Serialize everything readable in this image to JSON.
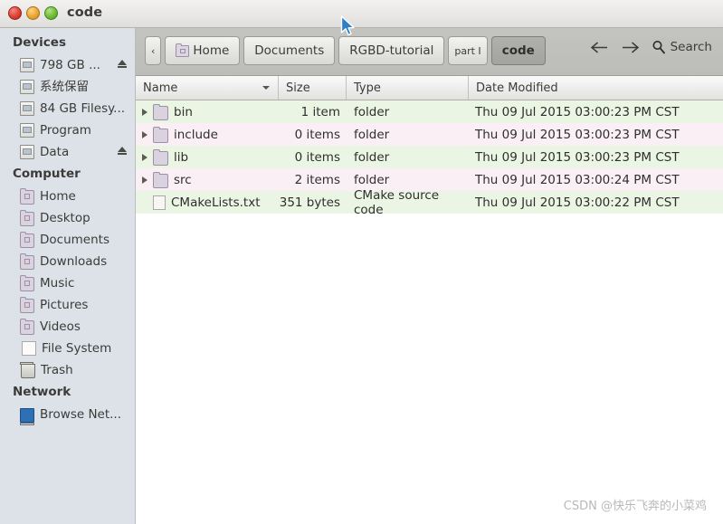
{
  "window": {
    "title": "code",
    "buttons": {
      "close": "close",
      "minimize": "minimize",
      "maximize": "maximize"
    }
  },
  "sidebar": {
    "groups": [
      {
        "heading": "Devices",
        "items": [
          {
            "label": "798 GB ...",
            "icon": "drive-icon",
            "eject": true
          },
          {
            "label": "系统保留",
            "icon": "drive-icon",
            "eject": false
          },
          {
            "label": "84 GB Filesy...",
            "icon": "drive-icon",
            "eject": false
          },
          {
            "label": "Program",
            "icon": "drive-icon",
            "eject": false
          },
          {
            "label": "Data",
            "icon": "drive-icon",
            "eject": true
          }
        ]
      },
      {
        "heading": "Computer",
        "items": [
          {
            "label": "Home",
            "icon": "folder-home-icon",
            "eject": false
          },
          {
            "label": "Desktop",
            "icon": "folder-desktop-icon",
            "eject": false
          },
          {
            "label": "Documents",
            "icon": "folder-documents-icon",
            "eject": false
          },
          {
            "label": "Downloads",
            "icon": "folder-downloads-icon",
            "eject": false
          },
          {
            "label": "Music",
            "icon": "folder-music-icon",
            "eject": false
          },
          {
            "label": "Pictures",
            "icon": "folder-pictures-icon",
            "eject": false
          },
          {
            "label": "Videos",
            "icon": "folder-videos-icon",
            "eject": false
          },
          {
            "label": "File System",
            "icon": "file-system-icon",
            "eject": false
          },
          {
            "label": "Trash",
            "icon": "trash-icon",
            "eject": false
          }
        ]
      },
      {
        "heading": "Network",
        "items": [
          {
            "label": "Browse Net...",
            "icon": "network-icon",
            "eject": false
          }
        ]
      }
    ]
  },
  "pathbar": {
    "overflow_label": "‹",
    "crumbs": [
      {
        "label": "Home",
        "active": false,
        "has_icon": true
      },
      {
        "label": "Documents",
        "active": false,
        "has_icon": false
      },
      {
        "label": "RGBD-tutorial",
        "active": false,
        "has_icon": false
      },
      {
        "label": "part I",
        "active": false,
        "has_icon": false
      },
      {
        "label": "code",
        "active": true,
        "has_icon": false
      }
    ],
    "back_label": "Back",
    "forward_label": "Forward",
    "search_label": "Search"
  },
  "columns": [
    {
      "key": "name",
      "label": "Name",
      "sorted": true
    },
    {
      "key": "size",
      "label": "Size",
      "sorted": false
    },
    {
      "key": "type",
      "label": "Type",
      "sorted": false
    },
    {
      "key": "date",
      "label": "Date Modified",
      "sorted": false
    }
  ],
  "files": [
    {
      "name": "bin",
      "size": "1 item",
      "type": "folder",
      "date": "Thu 09 Jul 2015 03:00:23 PM CST",
      "icon": "folder-icon",
      "expandable": true
    },
    {
      "name": "include",
      "size": "0 items",
      "type": "folder",
      "date": "Thu 09 Jul 2015 03:00:23 PM CST",
      "icon": "folder-icon",
      "expandable": true
    },
    {
      "name": "lib",
      "size": "0 items",
      "type": "folder",
      "date": "Thu 09 Jul 2015 03:00:23 PM CST",
      "icon": "folder-icon",
      "expandable": true
    },
    {
      "name": "src",
      "size": "2 items",
      "type": "folder",
      "date": "Thu 09 Jul 2015 03:00:24 PM CST",
      "icon": "folder-icon",
      "expandable": true
    },
    {
      "name": "CMakeLists.txt",
      "size": "351 bytes",
      "type": "CMake source code",
      "date": "Thu 09 Jul 2015 03:00:22 PM CST",
      "icon": "file-icon",
      "expandable": false
    }
  ],
  "watermark": "CSDN @快乐飞奔的小菜鸡",
  "colors": {
    "row_even": "#eaf5e3",
    "row_odd": "#fbeff6",
    "sidebar_bg": "#dde2e9",
    "pathbar_bg": "#bcbcb9",
    "folder": "#dbd2e0"
  }
}
